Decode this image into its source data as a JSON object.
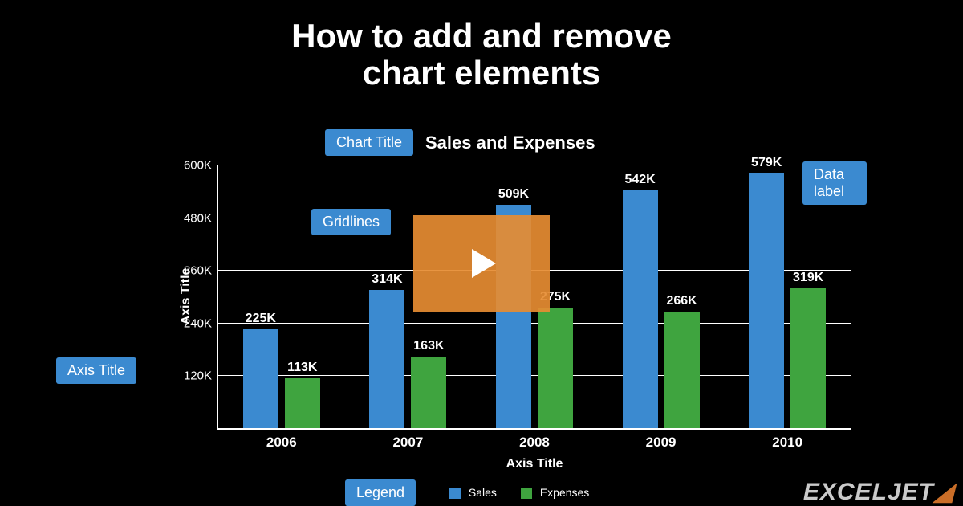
{
  "title_line1": "How to add and remove",
  "title_line2": "chart elements",
  "callouts": {
    "chart_title": "Chart Title",
    "gridlines": "Gridlines",
    "data_label": "Data label",
    "axis_title": "Axis Title",
    "legend": "Legend"
  },
  "chart_data": {
    "type": "bar",
    "title": "Sales and Expenses",
    "categories": [
      "2006",
      "2007",
      "2008",
      "2009",
      "2010"
    ],
    "series": [
      {
        "name": "Sales",
        "color": "#3b8ad0",
        "values": [
          225,
          314,
          509,
          542,
          579
        ],
        "labels": [
          "225K",
          "314K",
          "509K",
          "542K",
          "579K"
        ]
      },
      {
        "name": "Expenses",
        "color": "#3fa43f",
        "values": [
          113,
          163,
          275,
          266,
          319
        ],
        "labels": [
          "113K",
          "163K",
          "275K",
          "266K",
          "319K"
        ]
      }
    ],
    "xlabel": "Axis Title",
    "ylabel": "Axis Title",
    "ylim": [
      0,
      600
    ],
    "yticks": [
      120,
      240,
      360,
      480,
      600
    ],
    "ytick_labels": [
      "120K",
      "240K",
      "360K",
      "480K",
      "600K"
    ],
    "legend_position": "bottom"
  },
  "brand": {
    "text": "EXCELJET",
    "accent_glyph": "◢"
  },
  "play_button": "Play video"
}
